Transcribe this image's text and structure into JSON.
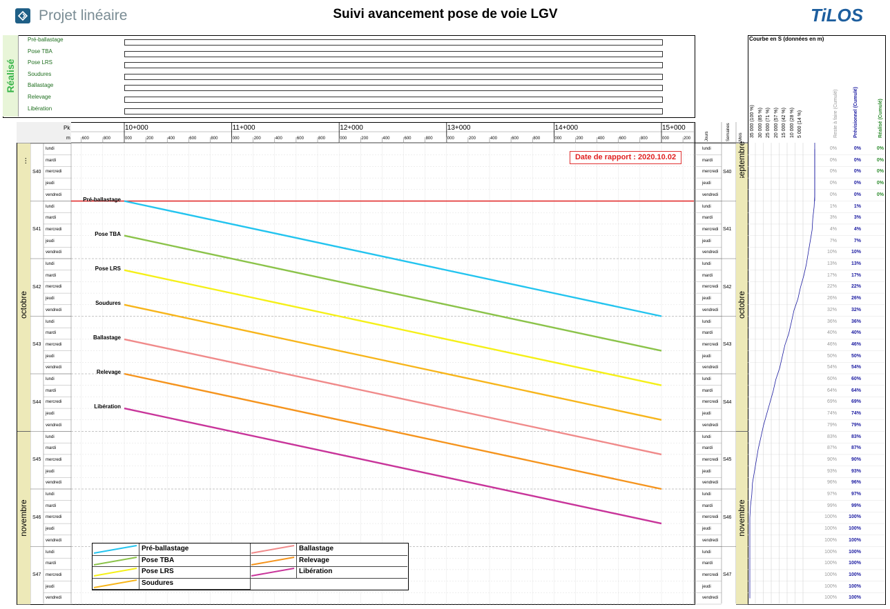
{
  "header": {
    "app_name": "Projet linéaire",
    "title": "Suivi avancement pose de voie LGV",
    "brand": "TiLOS"
  },
  "realise": {
    "label": "Réalisé",
    "activities": [
      "Pré-ballastage",
      "Pose TBA",
      "Pose LRS",
      "Soudures",
      "Ballastage",
      "Relevage",
      "Libération"
    ]
  },
  "axis": {
    "pk_label": "Pk",
    "m_label": "m",
    "pk_values": [
      "10+000",
      "11+000",
      "12+000",
      "13+000",
      "14+000",
      "15+000"
    ],
    "sub_ticks_first": [
      "600",
      "800"
    ],
    "sub_ticks": [
      "000",
      "200",
      "400",
      "600",
      "800"
    ],
    "last_sub": [
      "000",
      "200"
    ],
    "jours_label": "Jours",
    "semaines_label": "Semaines",
    "mois_label": "Mois"
  },
  "date_report": "Date de rapport : 2020.10.02",
  "calendar": {
    "days": [
      "lundi",
      "mardi",
      "mercredi",
      "jeudi",
      "vendredi"
    ],
    "weeks": [
      "S40",
      "S41",
      "S42",
      "S43",
      "S44",
      "S45",
      "S46",
      "S47"
    ],
    "months": [
      "septembre",
      "octobre",
      "novembre"
    ],
    "left_months": [
      "...",
      "octobre",
      "novembre"
    ]
  },
  "chart_data": {
    "type": "line",
    "title": "",
    "series": [
      {
        "name": "Pré-ballastage",
        "color": "#23c4ef",
        "start_pk": 10000,
        "end_pk": 15000,
        "start_row": 5,
        "end_row": 15
      },
      {
        "name": "Pose TBA",
        "color": "#8bc34a",
        "start_pk": 10000,
        "end_pk": 15000,
        "start_row": 8,
        "end_row": 18
      },
      {
        "name": "Pose LRS",
        "color": "#f5f018",
        "start_pk": 10000,
        "end_pk": 15000,
        "start_row": 11,
        "end_row": 21
      },
      {
        "name": "Soudures",
        "color": "#f7b51b",
        "start_pk": 10000,
        "end_pk": 15000,
        "start_row": 14,
        "end_row": 24
      },
      {
        "name": "Ballastage",
        "color": "#f08a8a",
        "start_pk": 10000,
        "end_pk": 15000,
        "start_row": 17,
        "end_row": 27
      },
      {
        "name": "Relevage",
        "color": "#f5941d",
        "start_pk": 10000,
        "end_pk": 15000,
        "start_row": 20,
        "end_row": 30
      },
      {
        "name": "Libération",
        "color": "#c8359a",
        "start_pk": 10000,
        "end_pk": 15000,
        "start_row": 23,
        "end_row": 33
      }
    ],
    "report_row": 5
  },
  "scurve": {
    "title": "Courbe en S (données en m)",
    "axis_labels": [
      "35 000 (100 %)",
      "30 000 (85 %)",
      "25 000 (71 %)",
      "20 000 (57 %)",
      "15 000 (42 %)",
      "10 000 (28 %)",
      "5 000 (14 %)"
    ],
    "col_reste": "Reste à faire (Cumulé)",
    "col_prev": "Prévisionnel (Cumulé)",
    "col_real": "Réalisé (Cumulé)",
    "reste": [
      "0%",
      "0%",
      "0%",
      "0%",
      "0%",
      "1%",
      "3%",
      "4%",
      "7%",
      "10%",
      "13%",
      "17%",
      "22%",
      "26%",
      "32%",
      "36%",
      "40%",
      "46%",
      "50%",
      "54%",
      "60%",
      "64%",
      "69%",
      "74%",
      "79%",
      "83%",
      "87%",
      "90%",
      "93%",
      "96%",
      "97%",
      "99%",
      "100%",
      "100%",
      "100%",
      "100%",
      "100%",
      "100%",
      "100%",
      "100%"
    ],
    "prev": [
      "0%",
      "0%",
      "0%",
      "0%",
      "0%",
      "1%",
      "3%",
      "4%",
      "7%",
      "10%",
      "13%",
      "17%",
      "22%",
      "26%",
      "32%",
      "36%",
      "40%",
      "46%",
      "50%",
      "54%",
      "60%",
      "64%",
      "69%",
      "74%",
      "79%",
      "83%",
      "87%",
      "90%",
      "93%",
      "96%",
      "97%",
      "99%",
      "100%",
      "100%",
      "100%",
      "100%",
      "100%",
      "100%",
      "100%",
      "100%"
    ],
    "real": [
      "0%",
      "0%",
      "0%",
      "0%",
      "0%"
    ]
  }
}
